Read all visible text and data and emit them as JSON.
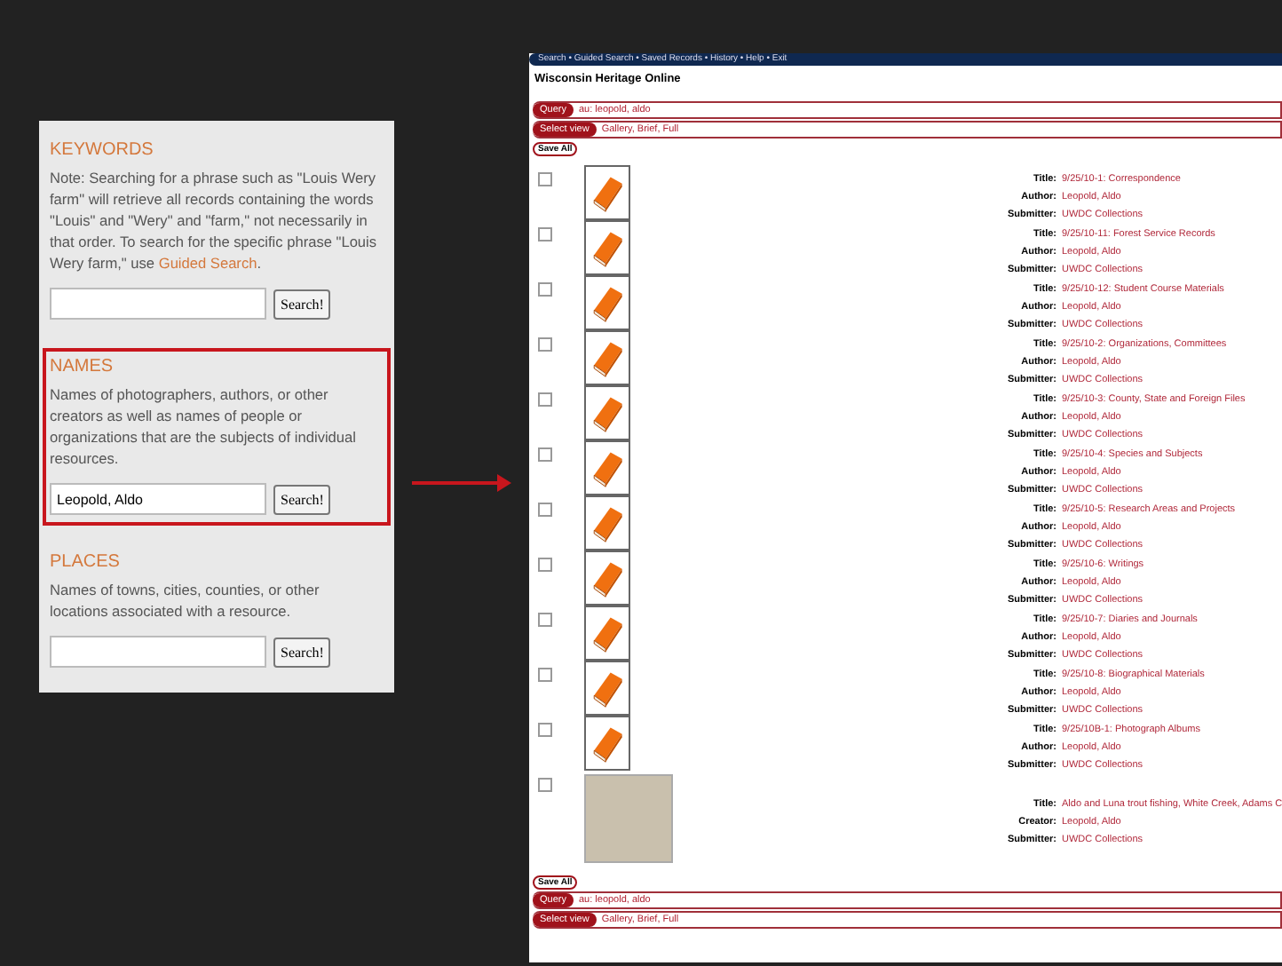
{
  "search_panel": {
    "sections": [
      {
        "heading": "KEYWORDS",
        "description": "Note: Searching for a phrase such as \"Louis Wery farm\" will retrieve all records containing the words \"Louis\" and \"Wery\" and \"farm,\" not necessarily in that order. To search for the specific phrase \"Louis Wery farm,\" use",
        "link": "Guided Search",
        "link_end": ".",
        "button": "Search!",
        "highlighted": false
      },
      {
        "heading": "NAMES",
        "description": "Names of photographers, authors, or other creators as well as names of people or organizations that are the subjects of individual resources.",
        "value": "Leopold, Aldo",
        "button": "Search!",
        "highlighted": true
      },
      {
        "heading": "PLACES",
        "description": "Names of towns, cities, counties, or other locations associated with a resource.",
        "button": "Search!",
        "highlighted": false
      }
    ]
  },
  "results_page": {
    "nav": "Search • Guided Search • Saved Records • History • Help • Exit",
    "site_title": "Wisconsin Heritage Online",
    "top_bars": [
      {
        "label": "Query",
        "value": "au: leopold, aldo"
      },
      {
        "label": "Select view",
        "value": "Gallery, Brief, Full"
      }
    ],
    "save_all_top": "Save All",
    "records": [
      {
        "kind": "book",
        "checked": false,
        "fields": [
          {
            "label": "Title:",
            "value": "9/25/10-1: Correspondence"
          },
          {
            "label": "Author:",
            "value": "Leopold, Aldo"
          },
          {
            "label": "Submitter:",
            "value": "UWDC Collections"
          }
        ]
      },
      {
        "kind": "book",
        "checked": false,
        "fields": [
          {
            "label": "Title:",
            "value": "9/25/10-11: Forest Service Records"
          },
          {
            "label": "Author:",
            "value": "Leopold, Aldo"
          },
          {
            "label": "Submitter:",
            "value": "UWDC Collections"
          }
        ]
      },
      {
        "kind": "book",
        "checked": false,
        "fields": [
          {
            "label": "Title:",
            "value": "9/25/10-12: Student Course Materials"
          },
          {
            "label": "Author:",
            "value": "Leopold, Aldo"
          },
          {
            "label": "Submitter:",
            "value": "UWDC Collections"
          }
        ]
      },
      {
        "kind": "book",
        "checked": false,
        "fields": [
          {
            "label": "Title:",
            "value": "9/25/10-2: Organizations, Committees"
          },
          {
            "label": "Author:",
            "value": "Leopold, Aldo"
          },
          {
            "label": "Submitter:",
            "value": "UWDC Collections"
          }
        ]
      },
      {
        "kind": "book",
        "checked": false,
        "fields": [
          {
            "label": "Title:",
            "value": "9/25/10-3: County, State and Foreign Files"
          },
          {
            "label": "Author:",
            "value": "Leopold, Aldo"
          },
          {
            "label": "Submitter:",
            "value": "UWDC Collections"
          }
        ]
      },
      {
        "kind": "book",
        "checked": false,
        "fields": [
          {
            "label": "Title:",
            "value": "9/25/10-4: Species and Subjects"
          },
          {
            "label": "Author:",
            "value": "Leopold, Aldo"
          },
          {
            "label": "Submitter:",
            "value": "UWDC Collections"
          }
        ]
      },
      {
        "kind": "book",
        "checked": false,
        "fields": [
          {
            "label": "Title:",
            "value": "9/25/10-5: Research Areas and Projects"
          },
          {
            "label": "Author:",
            "value": "Leopold, Aldo"
          },
          {
            "label": "Submitter:",
            "value": "UWDC Collections"
          }
        ]
      },
      {
        "kind": "book",
        "checked": false,
        "fields": [
          {
            "label": "Title:",
            "value": "9/25/10-6: Writings"
          },
          {
            "label": "Author:",
            "value": "Leopold, Aldo"
          },
          {
            "label": "Submitter:",
            "value": "UWDC Collections"
          }
        ]
      },
      {
        "kind": "book",
        "checked": false,
        "fields": [
          {
            "label": "Title:",
            "value": "9/25/10-7: Diaries and Journals"
          },
          {
            "label": "Author:",
            "value": "Leopold, Aldo"
          },
          {
            "label": "Submitter:",
            "value": "UWDC Collections"
          }
        ]
      },
      {
        "kind": "book",
        "checked": false,
        "fields": [
          {
            "label": "Title:",
            "value": "9/25/10-8: Biographical Materials"
          },
          {
            "label": "Author:",
            "value": "Leopold, Aldo"
          },
          {
            "label": "Submitter:",
            "value": "UWDC Collections"
          }
        ]
      },
      {
        "kind": "book",
        "checked": false,
        "fields": [
          {
            "label": "Title:",
            "value": "9/25/10B-1: Photograph Albums"
          },
          {
            "label": "Author:",
            "value": "Leopold, Aldo"
          },
          {
            "label": "Submitter:",
            "value": "UWDC Collections"
          }
        ]
      },
      {
        "kind": "photo",
        "checked": false,
        "fields": [
          {
            "label": "Title:",
            "value": "Aldo and Luna trout fishing, White Creek, Adams C"
          },
          {
            "label": "Creator:",
            "value": "Leopold, Aldo"
          },
          {
            "label": "Submitter:",
            "value": "UWDC Collections"
          }
        ]
      }
    ],
    "save_all_bottom": "Save All",
    "bottom_bars": [
      {
        "label": "Query",
        "value": "au: leopold, aldo"
      },
      {
        "label": "Select view",
        "value": "Gallery, Brief, Full"
      }
    ]
  }
}
